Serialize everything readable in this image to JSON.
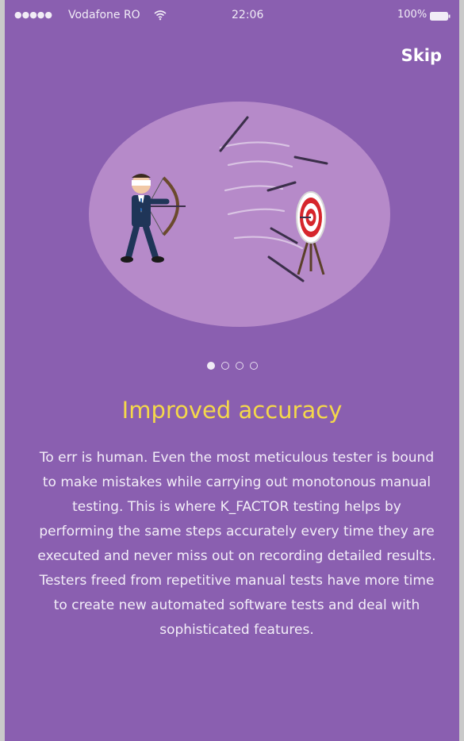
{
  "status_bar": {
    "signal": "●●●●●",
    "carrier": "Vodafone RO",
    "time": "22:06",
    "battery_percent": "100%",
    "icons": [
      "wifi-icon",
      "battery-icon"
    ]
  },
  "header": {
    "skip_label": "Skip"
  },
  "illustration": {
    "subject": "archer-hitting-target-illustration"
  },
  "pager": {
    "total_pages": 4,
    "current_page": 1
  },
  "content": {
    "title": "Improved accuracy",
    "body": "To err is human. Even the most meticulous tester is bound to make mistakes while carrying out monotonous manual testing. This is where K_FACTOR testing helps by performing the same steps accurately every time they are executed and never miss out on recording detailed results. Testers freed from repetitive manual tests have more time to create new automated software tests and deal with sophisticated features."
  },
  "colors": {
    "background": "#8a5fb0",
    "title": "#f4d84a",
    "illustration_circle": "#b68ac9"
  }
}
